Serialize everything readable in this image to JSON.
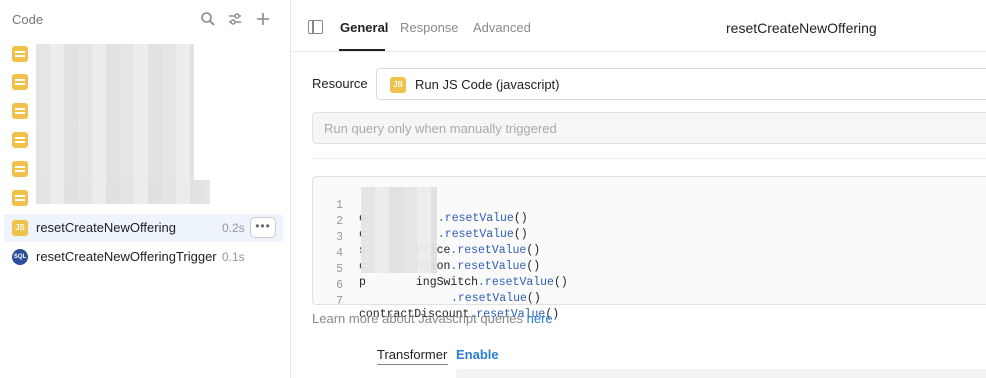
{
  "sidebar": {
    "title": "Code",
    "search_icon": "search-icon",
    "filter_icon": "sliders-icon",
    "add_icon": "plus-icon",
    "items": [
      {
        "label": "resetCreateNewOffering",
        "time": "0.2s",
        "icon": "js-icon",
        "icon_text": "JS",
        "active": true
      },
      {
        "label": "resetCreateNewOfferingTrigger",
        "time": "0.1s",
        "icon": "sql-icon",
        "icon_text": "SQL",
        "active": false
      }
    ],
    "more_label": "•••"
  },
  "tabs": [
    {
      "label": "General",
      "active": true
    },
    {
      "label": "Response",
      "active": false
    },
    {
      "label": "Advanced",
      "active": false
    }
  ],
  "query_title": "resetCreateNewOffering",
  "resource": {
    "label": "Resource",
    "icon_text": "JS",
    "value": "Run JS Code (javascript)"
  },
  "trigger": {
    "placeholder": "Run query only when manually triggered"
  },
  "code": {
    "lines": [
      {
        "n": "1",
        "pre": "o",
        "obj": "",
        "method": ".resetValue",
        "post": "()"
      },
      {
        "n": "2",
        "pre": "c",
        "obj": "",
        "method": ".resetValue",
        "post": "()"
      },
      {
        "n": "3",
        "pre": "s",
        "obj": "Price",
        "method": ".resetValue",
        "post": "()"
      },
      {
        "n": "4",
        "pre": "c",
        "obj": "nsion",
        "method": ".resetValue",
        "post": "()"
      },
      {
        "n": "5",
        "pre": "p",
        "obj": "ingSwitch",
        "method": ".resetValue",
        "post": "()"
      },
      {
        "n": "6",
        "pre": "",
        "obj": "",
        "method": ".resetValue",
        "post": "()"
      },
      {
        "n": "7",
        "pre": "contractDiscount",
        "obj": "",
        "method": ".resetValue",
        "post": "()"
      }
    ]
  },
  "help": {
    "text": "Learn more about Javascript queries ",
    "link": "here"
  },
  "transformer": {
    "label": "Transformer",
    "enable": "Enable"
  },
  "colors": {
    "accent": "#2a7fd4",
    "js": "#f0c14b",
    "sql": "#2d4e9a",
    "active_row": "#eef4fc"
  }
}
